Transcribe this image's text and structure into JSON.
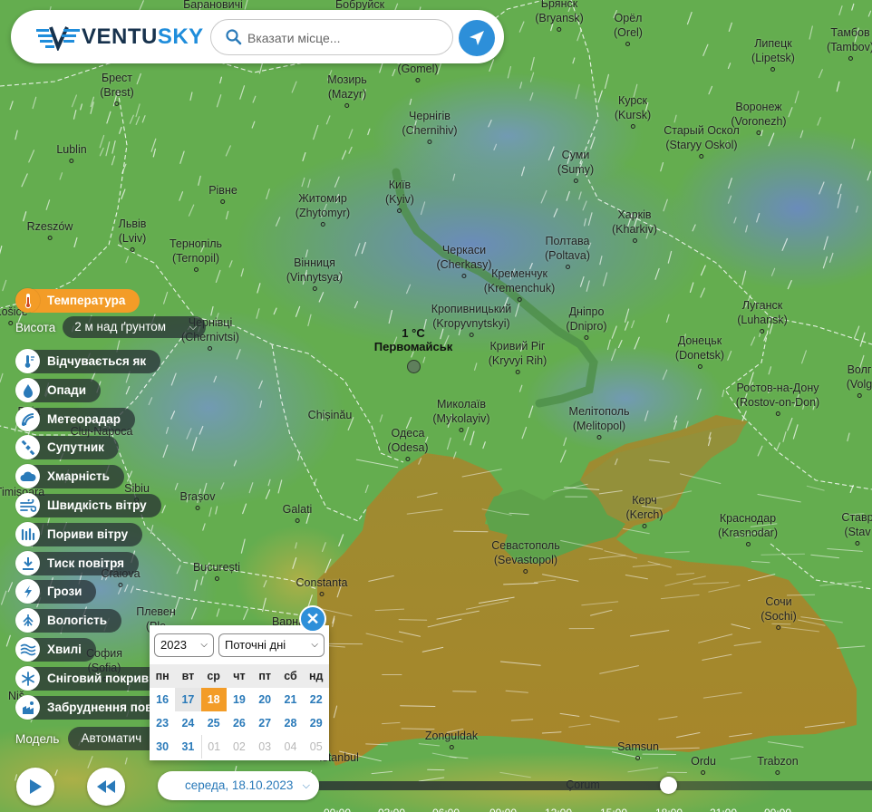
{
  "header": {
    "logo_prefix": "VENTU",
    "logo_suffix": "SKY",
    "search_placeholder": "Вказати місце..."
  },
  "selected_point": {
    "temperature": "1 °C",
    "name": "Первомайськ"
  },
  "cities": [
    {
      "name": "Барановичі",
      "id": "baranovichi"
    },
    {
      "name": "Бобруйск",
      "id": "bobruisk"
    },
    {
      "name": "Брянск",
      "latin": "(Bryansk)",
      "id": "bryansk"
    },
    {
      "name": "Орёл",
      "latin": "(Orel)",
      "id": "orel"
    },
    {
      "name": "Тамбов",
      "latin": "(Tambov)",
      "id": "tambov"
    },
    {
      "name": "Брест",
      "latin": "(Brest)",
      "id": "brest"
    },
    {
      "name": "Мозирь",
      "latin": "(Mazyr)",
      "id": "mazyr"
    },
    {
      "name": "(Gomel)",
      "id": "gomel"
    },
    {
      "name": "Липецк",
      "latin": "(Lipetsk)",
      "id": "lipetsk"
    },
    {
      "name": "Курск",
      "latin": "(Kursk)",
      "id": "kursk"
    },
    {
      "name": "Воронеж",
      "latin": "(Voronezh)",
      "id": "voronezh"
    },
    {
      "name": "Чернігів",
      "latin": "(Chernihiv)",
      "id": "chernihiv"
    },
    {
      "name": "Старый Оскол",
      "latin": "(Staryy Oskol)",
      "id": "oskol"
    },
    {
      "name": "Lublin",
      "id": "lublin"
    },
    {
      "name": "Суми",
      "latin": "(Sumy)",
      "id": "sumy"
    },
    {
      "name": "Київ",
      "latin": "(Kyiv)",
      "id": "kyiv"
    },
    {
      "name": "Рівне",
      "id": "rivne"
    },
    {
      "name": "Житомир",
      "latin": "(Zhytomyr)",
      "id": "zhytomyr"
    },
    {
      "name": "Rzeszów",
      "id": "rzeszow"
    },
    {
      "name": "Львів",
      "latin": "(Lviv)",
      "id": "lviv"
    },
    {
      "name": "Харків",
      "latin": "(Kharkiv)",
      "id": "kharkiv"
    },
    {
      "name": "Тернопіль",
      "latin": "(Ternopil)",
      "id": "ternopil"
    },
    {
      "name": "Черкаси",
      "latin": "(Cherkasy)",
      "id": "cherkasy"
    },
    {
      "name": "Полтава",
      "latin": "(Poltava)",
      "id": "poltava"
    },
    {
      "name": "Вінниця",
      "latin": "(Vinnytsya)",
      "id": "vinnytsya"
    },
    {
      "name": "Кременчук",
      "latin": "(Kremenchuk)",
      "id": "kremenchuk"
    },
    {
      "name": "Кропивницький",
      "latin": "(Kropyvnytskyi)",
      "id": "kropyvnytskyi"
    },
    {
      "name": "Дніпро",
      "latin": "(Dnipro)",
      "id": "dnipro"
    },
    {
      "name": "Луганск",
      "latin": "(Luhansk)",
      "id": "luhansk"
    },
    {
      "name": "Košice",
      "id": "kosice"
    },
    {
      "name": "Чернівці",
      "latin": "(Chernivtsi)",
      "id": "chernivtsi"
    },
    {
      "name": "Кривий Ріг",
      "latin": "(Kryvyi Rih)",
      "id": "kryvyirih"
    },
    {
      "name": "Донецьк",
      "latin": "(Donetsk)",
      "id": "donetsk"
    },
    {
      "name": "Волг",
      "latin": "(Volg",
      "id": "volgograd"
    },
    {
      "name": "Ростов-на-Дону",
      "latin": "(Rostov-on-Don)",
      "id": "rostov"
    },
    {
      "name": "Миколаїв",
      "latin": "(Mykolayiv)",
      "id": "mykolayiv"
    },
    {
      "name": "Chișinău",
      "id": "chisinau"
    },
    {
      "name": "Мелітополь",
      "latin": "(Melitopol)",
      "id": "melitopol"
    },
    {
      "name": "Одеса",
      "latin": "(Odesa)",
      "id": "odesa"
    },
    {
      "name": "Baia",
      "id": "baia"
    },
    {
      "name": "Cluj-Napoca",
      "id": "cluj"
    },
    {
      "name": "Sibiu",
      "id": "sibiu"
    },
    {
      "name": "Brașov",
      "id": "brasov"
    },
    {
      "name": "Керч",
      "latin": "(Kerch)",
      "id": "kerch"
    },
    {
      "name": "Galati",
      "id": "galati"
    },
    {
      "name": "Краснодар",
      "latin": "(Krasnodar)",
      "id": "krasnodar"
    },
    {
      "name": "Ставр",
      "latin": "(Stav",
      "id": "stavropol"
    },
    {
      "name": "Timișoara",
      "id": "timisoara"
    },
    {
      "name": "Севастополь",
      "latin": "(Sevastopol)",
      "id": "sevastopol"
    },
    {
      "name": "București",
      "id": "bucuresti"
    },
    {
      "name": "Craiova",
      "id": "craiova"
    },
    {
      "name": "Constanta",
      "id": "constanta"
    },
    {
      "name": "Сочи",
      "latin": "(Sochi)",
      "id": "sochi"
    },
    {
      "name": "Плевен",
      "latin": "(Ple",
      "id": "pleven"
    },
    {
      "name": "Варна",
      "id": "varna"
    },
    {
      "name": "София",
      "latin": "(Sofia)",
      "id": "sofia"
    },
    {
      "name": "Zonguldak",
      "id": "zonguldak"
    },
    {
      "name": "Samsun",
      "id": "samsun"
    },
    {
      "name": "Ordu",
      "id": "ordu"
    },
    {
      "name": "Trabzon",
      "id": "trabzon"
    },
    {
      "name": "İstanbul",
      "id": "istanbul"
    },
    {
      "name": "Çorum",
      "id": "corum"
    },
    {
      "name": "Niš",
      "id": "nis"
    }
  ],
  "layers": {
    "active": "Температура",
    "height_label": "Висота",
    "height_value": "2 м над ґрунтом",
    "items": [
      {
        "label": "Відчувається як",
        "icon": "feels-like-icon"
      },
      {
        "label": "Опади",
        "icon": "drop-icon"
      },
      {
        "label": "Метеорадар",
        "icon": "radar-icon"
      },
      {
        "label": "Супутник",
        "icon": "satellite-icon"
      },
      {
        "label": "Хмарність",
        "icon": "cloud-icon"
      },
      {
        "label": "Швидкість вітру",
        "icon": "wind-icon"
      },
      {
        "label": "Пориви вітру",
        "icon": "gusts-icon"
      },
      {
        "label": "Тиск повітря",
        "icon": "pressure-icon"
      },
      {
        "label": "Грози",
        "icon": "lightning-icon"
      },
      {
        "label": "Вологість",
        "icon": "humidity-icon"
      },
      {
        "label": "Хвилі",
        "icon": "waves-icon"
      },
      {
        "label": "Сніговий покрив",
        "icon": "snowflake-icon"
      },
      {
        "label": "Забруднення пов",
        "icon": "pollution-icon"
      }
    ],
    "model_label": "Модель",
    "model_value": "Автоматич"
  },
  "calendar": {
    "year": "2023",
    "range": "Поточні дні",
    "weekdays": [
      "пн",
      "вт",
      "ср",
      "чт",
      "пт",
      "сб",
      "нд"
    ],
    "weeks": [
      [
        "16",
        "17",
        "18",
        "19",
        "20",
        "21",
        "22"
      ],
      [
        "23",
        "24",
        "25",
        "26",
        "27",
        "28",
        "29"
      ],
      [
        "30",
        "31",
        "01",
        "02",
        "03",
        "04",
        "05"
      ]
    ],
    "selected_day": "18",
    "past_day": "17"
  },
  "timeline": {
    "current_date": "середа, 18.10.2023",
    "progress": 0.63,
    "tick_labels": [
      "00:00",
      "03:00",
      "06:00",
      "09:00",
      "12:00",
      "15:00",
      "18:00",
      "21:00",
      "00:00"
    ]
  },
  "colors": {
    "accent": "#2d8fd9",
    "active_layer": "#f39c27",
    "land_green": "#5fae4c",
    "cold_blue": "#6c92c0",
    "sea_olive": "#a18a2e"
  }
}
